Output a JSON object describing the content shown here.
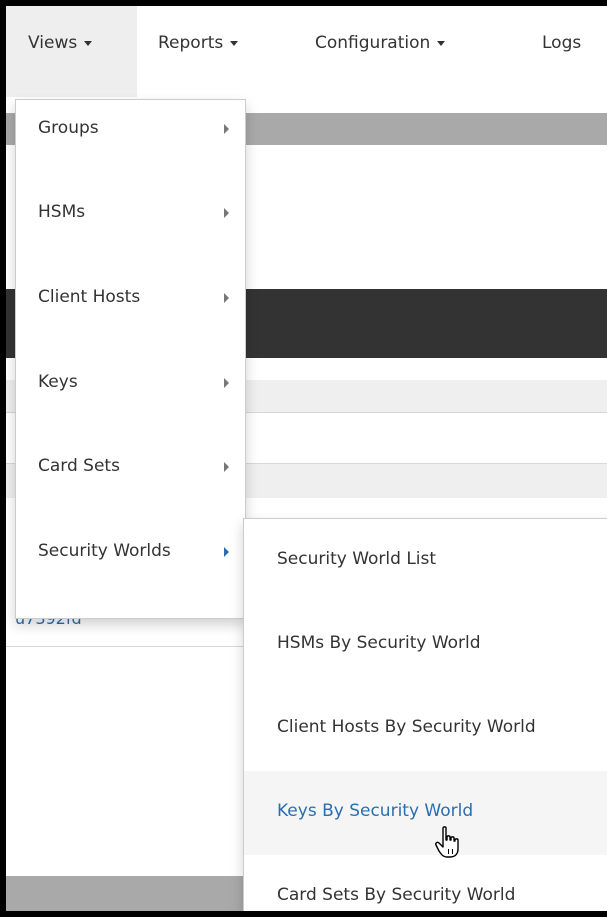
{
  "nav": {
    "views": "Views",
    "reports": "Reports",
    "configuration": "Configuration",
    "logs": "Logs"
  },
  "views_menu": {
    "items": [
      {
        "label": "Groups"
      },
      {
        "label": "HSMs"
      },
      {
        "label": "Client Hosts"
      },
      {
        "label": "Keys"
      },
      {
        "label": "Card Sets"
      },
      {
        "label": "Security Worlds",
        "active": true
      }
    ]
  },
  "security_worlds_submenu": {
    "items": [
      {
        "label": "Security World List"
      },
      {
        "label": "HSMs By Security World"
      },
      {
        "label": "Client Hosts By Security World"
      },
      {
        "label": "Keys By Security World",
        "hovered": true
      },
      {
        "label": "Card Sets By Security World"
      }
    ]
  },
  "background": {
    "link_fragment": "u7392fd"
  },
  "colors": {
    "link_blue": "#2a6eb0",
    "dark_band": "#333333",
    "gray_band": "#a9a9a9",
    "menu_hover_bg": "#f5f5f5"
  },
  "cursor": "hand-pointer-icon"
}
